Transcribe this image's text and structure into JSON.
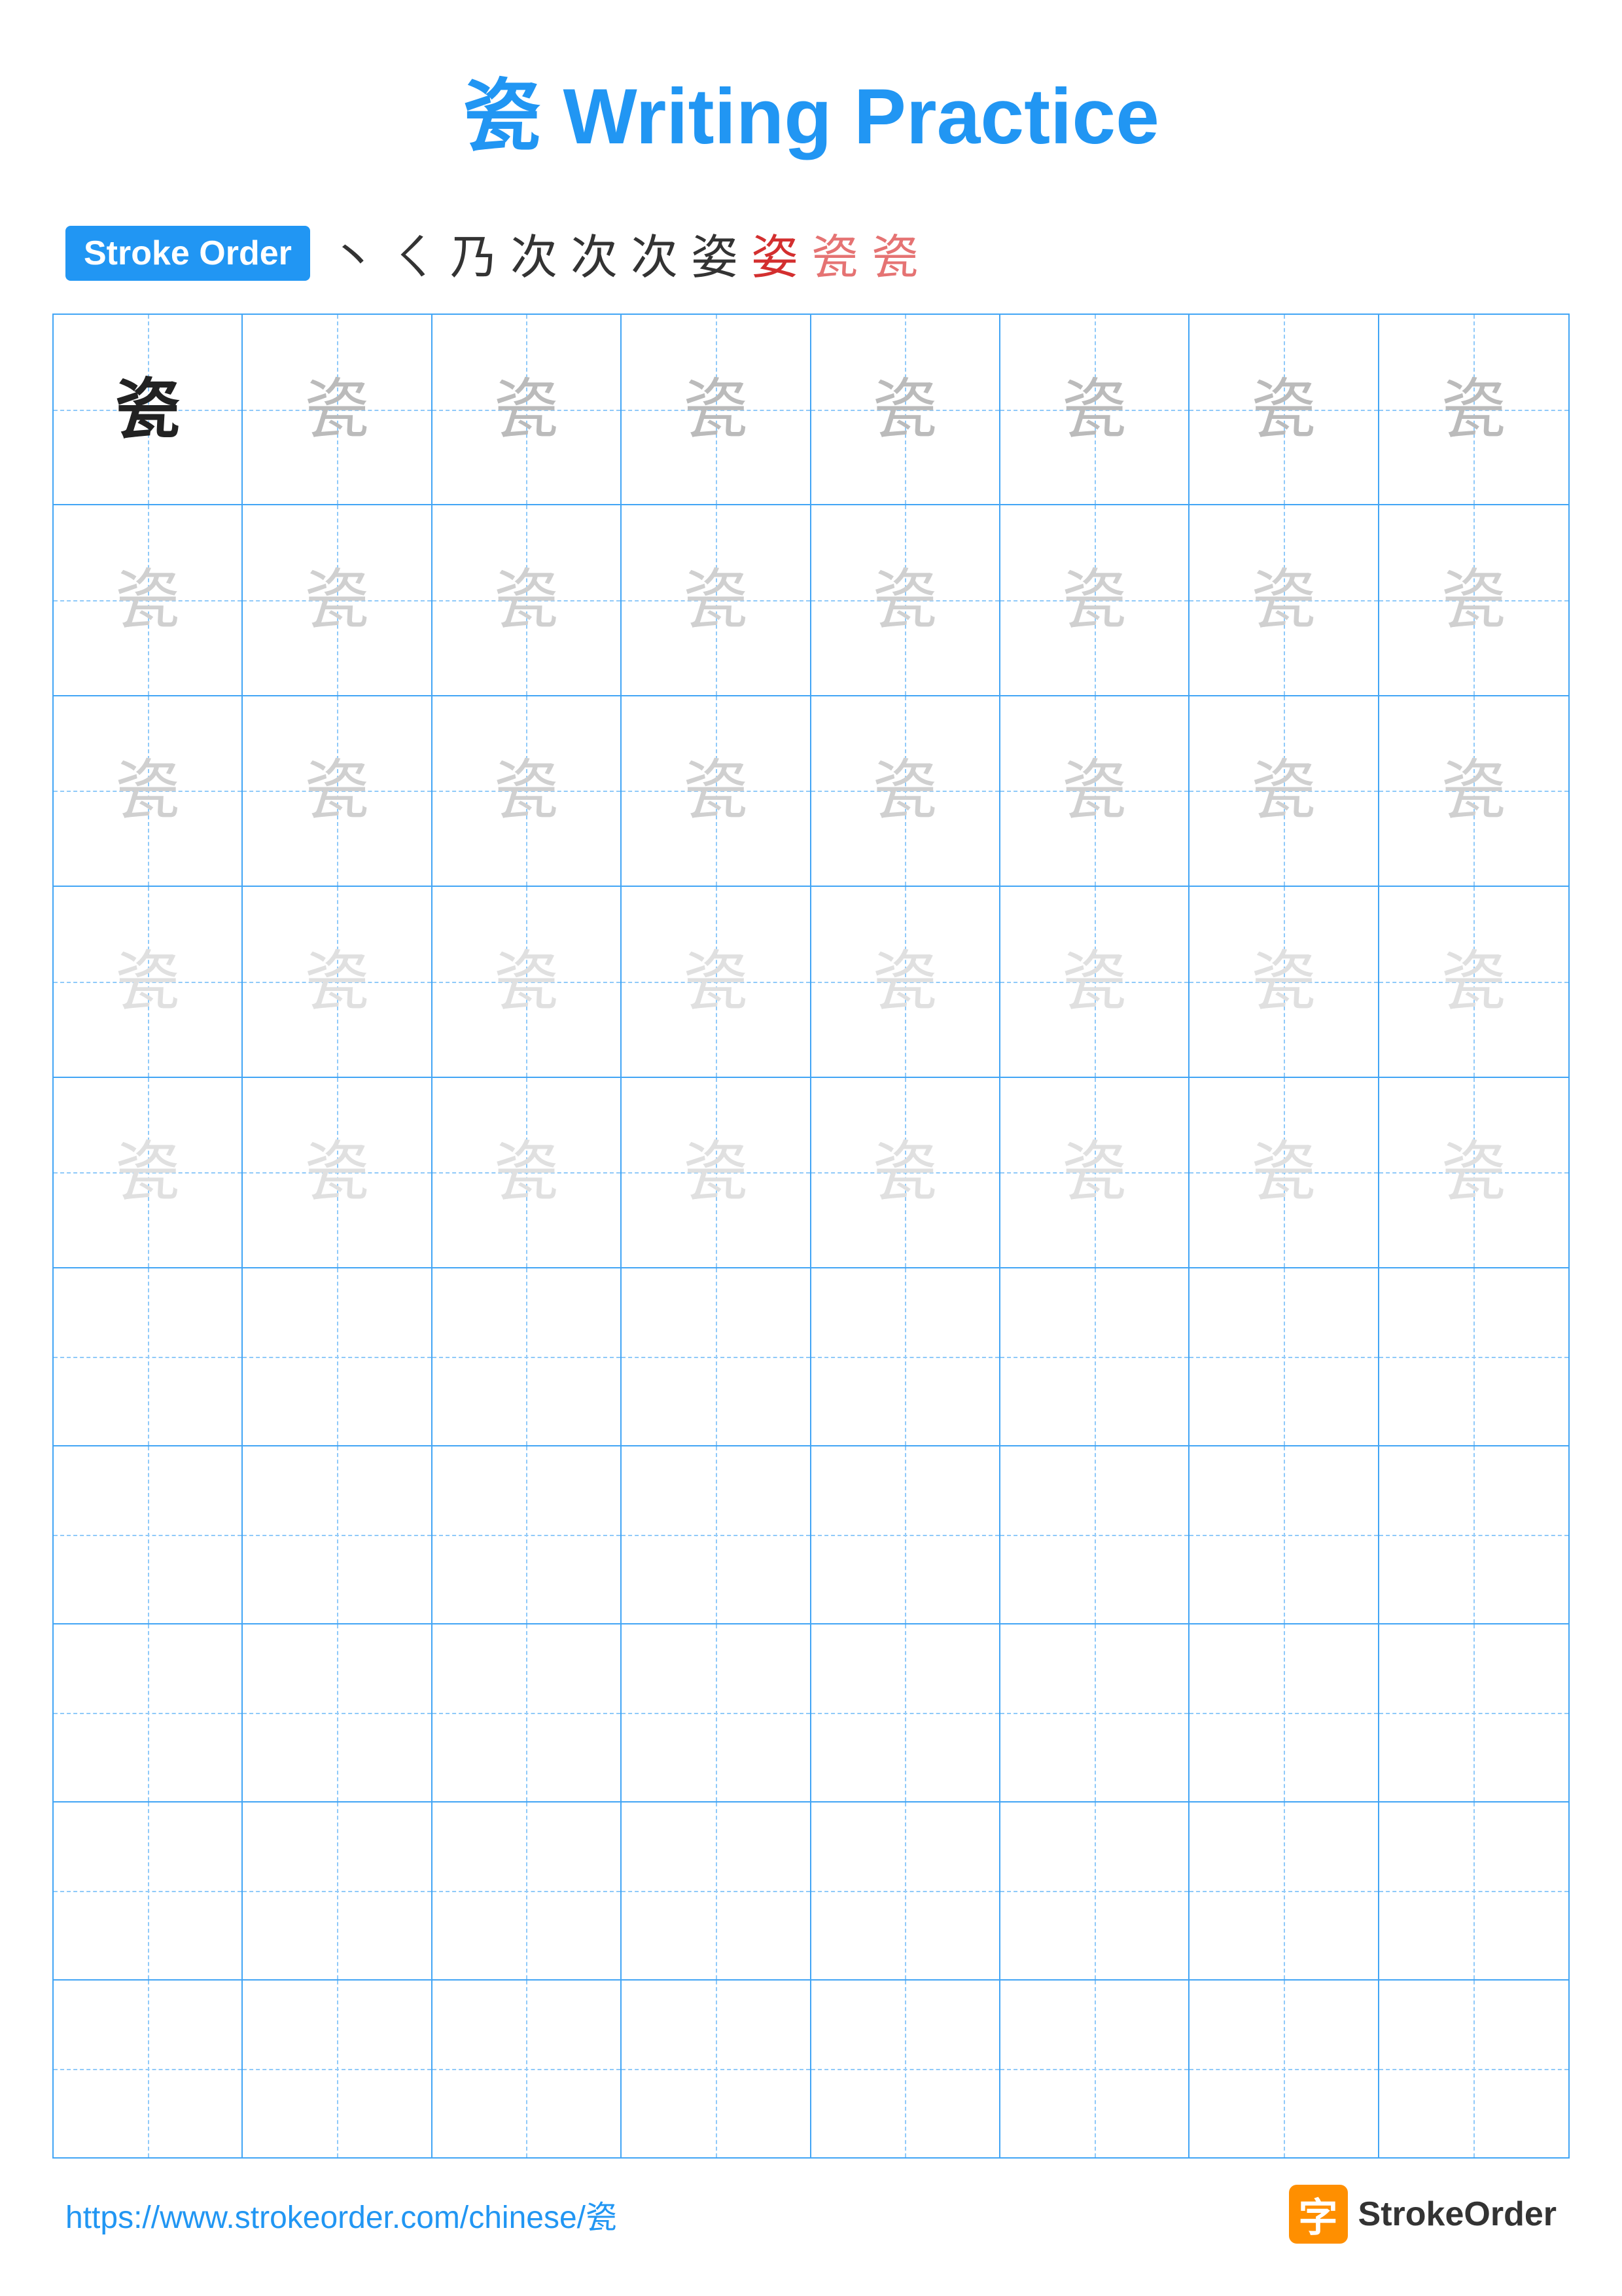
{
  "page": {
    "title": "瓷 Writing Practice",
    "title_char": "瓷",
    "title_text": "Writing Practice"
  },
  "stroke_order": {
    "badge_label": "Stroke Order",
    "strokes": [
      "丶",
      "ㄑ",
      "乃",
      "次",
      "次",
      "次",
      "姿",
      "姿",
      "瓷",
      "瓷"
    ]
  },
  "practice_rows": {
    "char": "瓷",
    "filled_rows": 5,
    "empty_rows": 5,
    "cols": 8
  },
  "footer": {
    "url": "https://www.strokeorder.com/chinese/瓷",
    "logo_text": "StrokeOrder",
    "logo_char": "字"
  }
}
